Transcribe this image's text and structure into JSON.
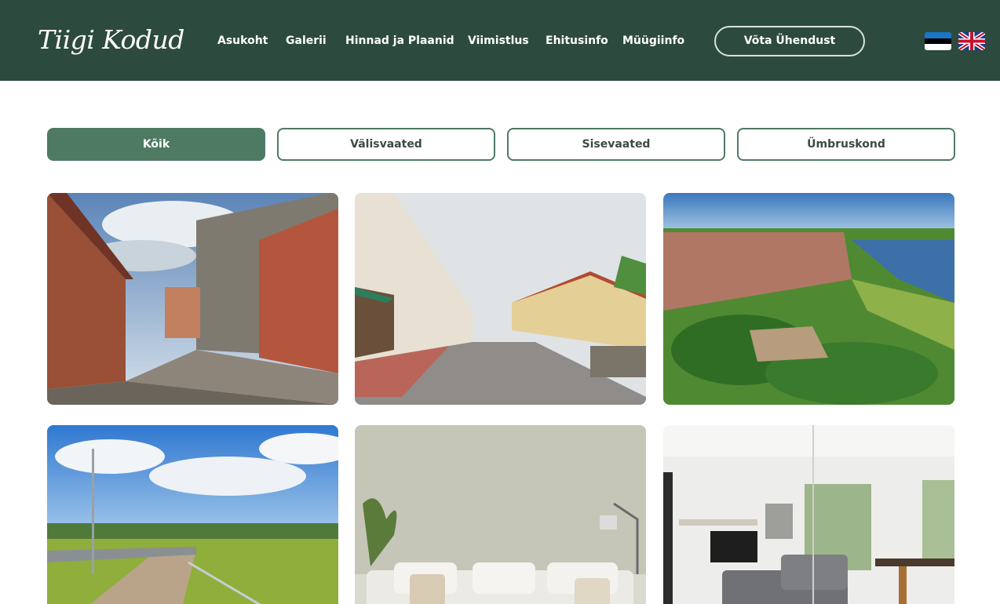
{
  "logo": {
    "text": "Tiigi Kodud"
  },
  "nav": {
    "items": [
      {
        "label": "Asukoht"
      },
      {
        "label": "Galerii"
      },
      {
        "label": "Hinnad ja Plaanid"
      },
      {
        "label": "Viimistlus"
      },
      {
        "label": "Ehitusinfo"
      },
      {
        "label": "Müügiinfo"
      }
    ],
    "contact_label": "Võta Ühendust"
  },
  "languages": [
    {
      "icon": "estonian-flag-icon"
    },
    {
      "icon": "uk-flag-icon"
    }
  ],
  "filters": [
    {
      "label": "Kõik",
      "active": true
    },
    {
      "label": "Välisvaated",
      "active": false
    },
    {
      "label": "Sisevaated",
      "active": false
    },
    {
      "label": "Ümbruskond",
      "active": false
    }
  ],
  "colors": {
    "header_bg": "#2d4a3e",
    "accent": "#4e7a63",
    "text_dark": "#3b4a42"
  },
  "gallery": [
    {
      "subject": "old-town-cobblestone-street"
    },
    {
      "subject": "town-main-street"
    },
    {
      "subject": "aerial-view-river-town"
    },
    {
      "subject": "countryside-road-sky"
    },
    {
      "subject": "living-room-sofa-interior"
    },
    {
      "subject": "open-plan-kitchen-living-interior"
    }
  ]
}
